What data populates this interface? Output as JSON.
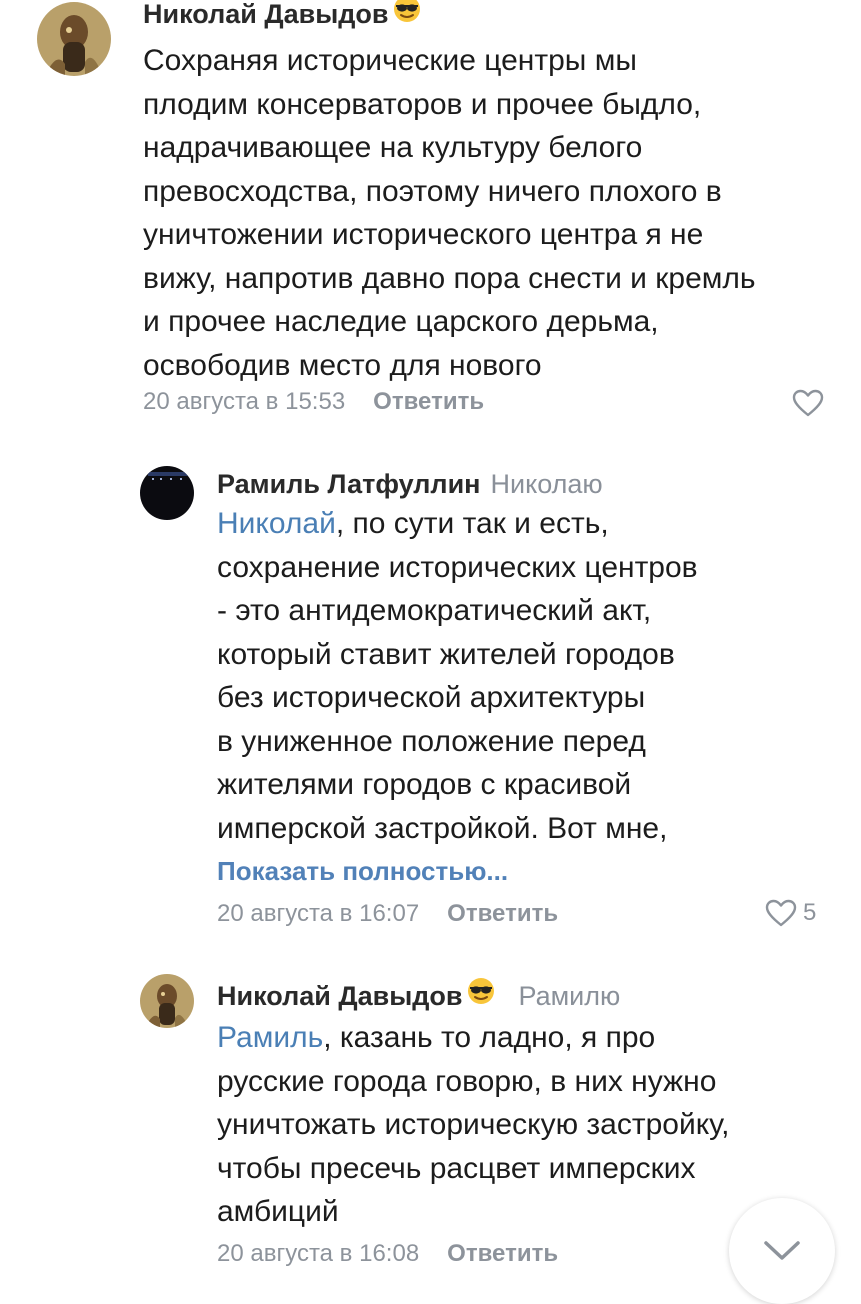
{
  "comments": [
    {
      "author": "Николай Давыдов",
      "author_emoji": "sunglasses-emoji",
      "reply_to": "",
      "lines": [
        "Сохраняя исторические центры мы",
        "плодим консерваторов и прочее быдло,",
        "надрачивающее на культуру белого",
        "превосходства, поэтому ничего плохого в",
        "уничтожении исторического центра я не",
        "вижу, напротив давно пора снести и кремль",
        "и прочее наследие царского дерьма,",
        "освободив место для  нового"
      ],
      "timestamp": "20 августа в 15:53",
      "reply_label": "Ответить",
      "likes": ""
    },
    {
      "author": "Рамиль Латфуллин",
      "reply_to": "Николаю",
      "mention": "Николай",
      "first_line_rest": ", по сути так и есть,",
      "lines": [
        "сохранение исторических центров",
        "- это антидемократический акт,",
        "который ставит жителей городов",
        "без исторической архитектуры",
        "в униженное положение перед",
        "жителями городов с красивой",
        "имперской застройкой. Вот мне,"
      ],
      "show_more": "Показать полностью...",
      "timestamp": "20 августа в 16:07",
      "reply_label": "Ответить",
      "likes": "5"
    },
    {
      "author": "Николай Давыдов",
      "author_emoji": "sunglasses-emoji",
      "reply_to": "Рамилю",
      "mention": "Рамиль",
      "first_line_rest": ", казань то ладно, я про",
      "lines": [
        "русские города говорю, в них нужно",
        "уничтожать историческую застройку,",
        "чтобы пресечь расцвет имперских",
        "амбиций"
      ],
      "timestamp": "20 августа в 16:08",
      "reply_label": "Ответить",
      "likes": ""
    }
  ],
  "icons": {
    "like": "heart-outline-icon",
    "scroll_down": "chevron-down-icon"
  },
  "colors": {
    "mention": "#4a7fb5",
    "link": "#5181b8",
    "meta": "#8d939b"
  }
}
